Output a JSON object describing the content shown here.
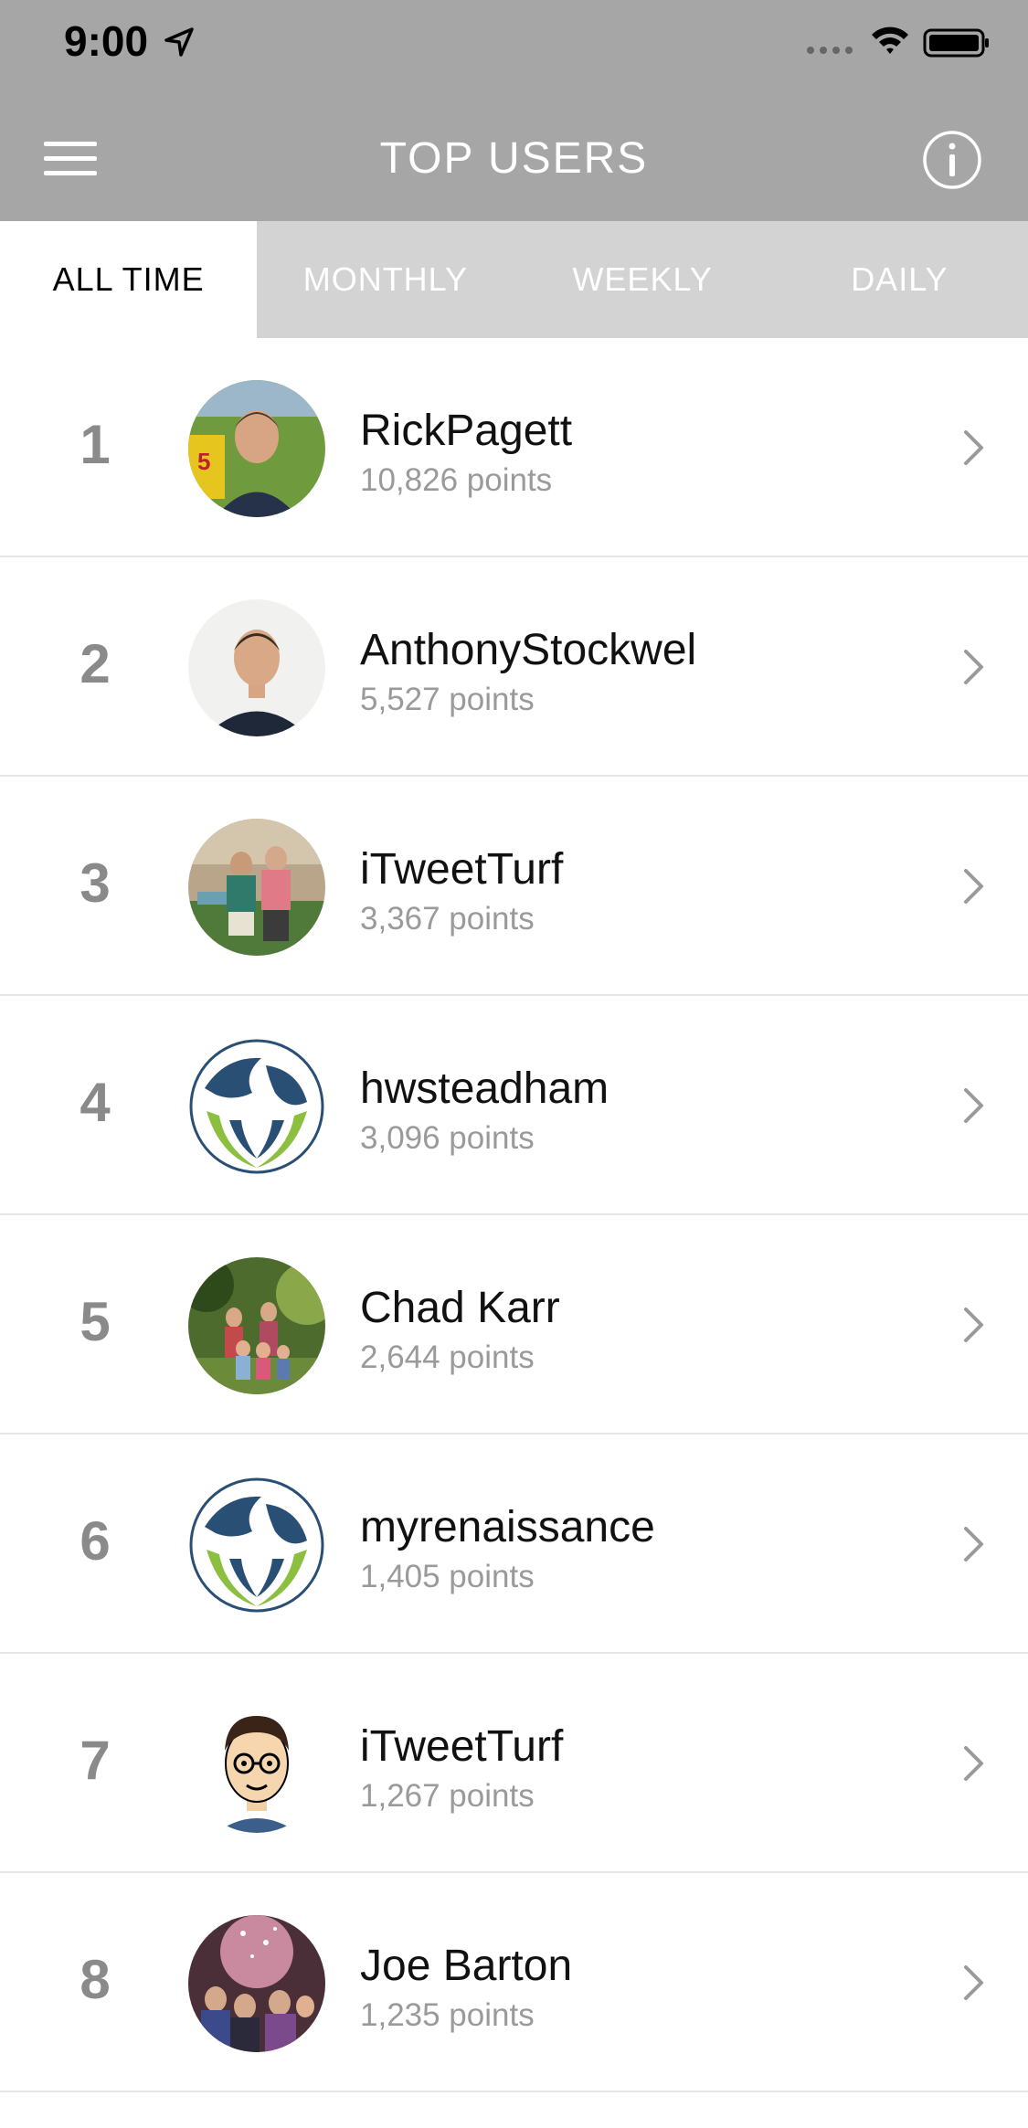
{
  "status_bar": {
    "time": "9:00"
  },
  "header": {
    "title": "TOP USERS"
  },
  "tabs": [
    {
      "label": "ALL TIME",
      "active": true
    },
    {
      "label": "MONTHLY",
      "active": false
    },
    {
      "label": "WEEKLY",
      "active": false
    },
    {
      "label": "DAILY",
      "active": false
    }
  ],
  "users": [
    {
      "rank": "1",
      "name": "RickPagett",
      "points": "10,826 points",
      "avatar": "photo-avatar"
    },
    {
      "rank": "2",
      "name": "AnthonyStockwel",
      "points": "5,527 points",
      "avatar": "photo-avatar"
    },
    {
      "rank": "3",
      "name": "iTweetTurf",
      "points": "3,367 points",
      "avatar": "photo-avatar"
    },
    {
      "rank": "4",
      "name": "hwsteadham",
      "points": "3,096 points",
      "avatar": "globe-logo"
    },
    {
      "rank": "5",
      "name": "Chad Karr",
      "points": "2,644 points",
      "avatar": "photo-avatar"
    },
    {
      "rank": "6",
      "name": "myrenaissance",
      "points": "1,405 points",
      "avatar": "globe-logo"
    },
    {
      "rank": "7",
      "name": "iTweetTurf",
      "points": "1,267 points",
      "avatar": "cartoon-avatar"
    },
    {
      "rank": "8",
      "name": "Joe Barton",
      "points": "1,235 points",
      "avatar": "photo-avatar"
    }
  ],
  "colors": {
    "header_bg": "#a6a6a6",
    "tabs_bg": "#d3d3d3",
    "rank_text": "#8a8a8a",
    "points_text": "#9a9a9a"
  }
}
